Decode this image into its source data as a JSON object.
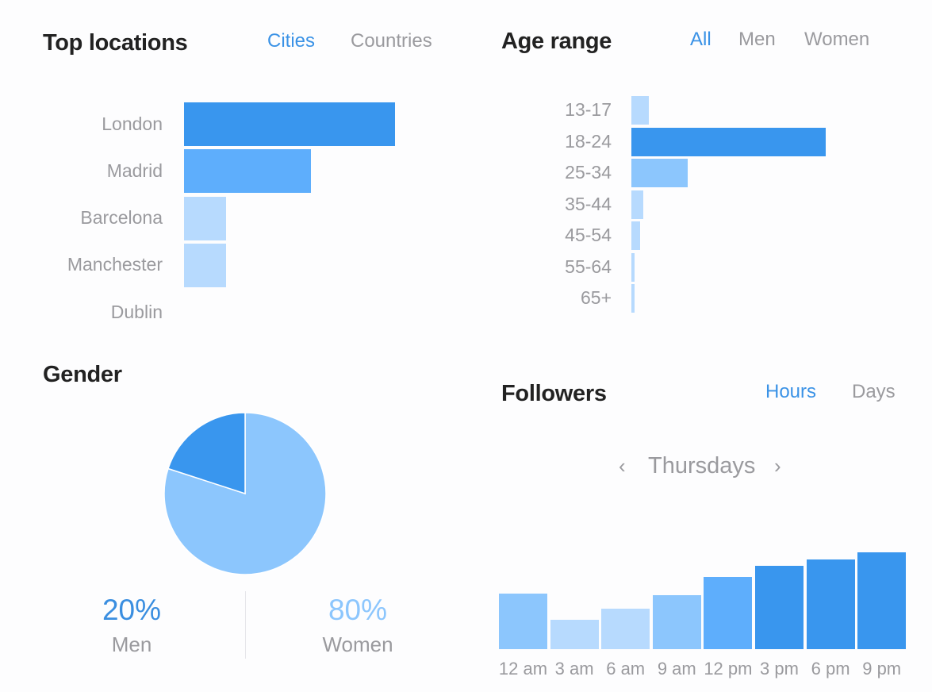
{
  "colors": {
    "accent": "#3a92e6",
    "bar_dark": "#3996ee",
    "bar_mid": "#5eaefc",
    "bar_light": "#8cc6fd",
    "bar_pale": "#b7dafe",
    "text_gray": "#9a9a9e",
    "title": "#222222"
  },
  "top_locations": {
    "title": "Top locations",
    "tabs": [
      {
        "label": "Cities",
        "active": true
      },
      {
        "label": "Countries",
        "active": false
      }
    ]
  },
  "age_range": {
    "title": "Age range",
    "tabs": [
      {
        "label": "All",
        "active": true
      },
      {
        "label": "Men",
        "active": false
      },
      {
        "label": "Women",
        "active": false
      }
    ]
  },
  "gender": {
    "title": "Gender",
    "men": {
      "percent": "20%",
      "label": "Men"
    },
    "women": {
      "percent": "80%",
      "label": "Women"
    }
  },
  "followers": {
    "title": "Followers",
    "tabs": [
      {
        "label": "Hours",
        "active": true
      },
      {
        "label": "Days",
        "active": false
      }
    ],
    "day_label": "Thursdays",
    "prev_icon": "chevron-left-icon",
    "next_icon": "chevron-right-icon"
  },
  "chart_data": [
    {
      "type": "bar",
      "orientation": "horizontal",
      "title": "Top locations",
      "categories": [
        "London",
        "Madrid",
        "Barcelona",
        "Manchester",
        "Dublin"
      ],
      "values": [
        100,
        60,
        20,
        20,
        0
      ],
      "value_units": "relative (max = 100)",
      "colors": [
        "#3996ee",
        "#5eaefc",
        "#b7dafe",
        "#b7dafe",
        "#b7dafe"
      ]
    },
    {
      "type": "bar",
      "orientation": "horizontal",
      "title": "Age range",
      "categories": [
        "13-17",
        "18-24",
        "25-34",
        "35-44",
        "45-54",
        "55-64",
        "65+"
      ],
      "values": [
        9,
        100,
        29,
        6,
        4.5,
        1.5,
        1.5
      ],
      "value_units": "relative (max = 100)",
      "colors": [
        "#b7dafe",
        "#3996ee",
        "#8cc6fd",
        "#b7dafe",
        "#b7dafe",
        "#b7dafe",
        "#b7dafe"
      ]
    },
    {
      "type": "pie",
      "title": "Gender",
      "labels": [
        "Men",
        "Women"
      ],
      "values": [
        20,
        80
      ],
      "colors": [
        "#3996ee",
        "#8cc6fd"
      ]
    },
    {
      "type": "bar",
      "orientation": "vertical",
      "title": "Followers",
      "subtitle": "Thursdays",
      "categories": [
        "12 am",
        "3 am",
        "6 am",
        "9 am",
        "12 pm",
        "3 pm",
        "6 pm",
        "9 pm"
      ],
      "values": [
        57,
        30,
        42,
        56,
        75,
        86,
        93,
        100
      ],
      "value_units": "relative (max = 100)",
      "colors": [
        "#8cc6fd",
        "#b7dafe",
        "#b7dafe",
        "#8cc6fd",
        "#5eaefc",
        "#3996ee",
        "#3996ee",
        "#3996ee"
      ]
    }
  ]
}
